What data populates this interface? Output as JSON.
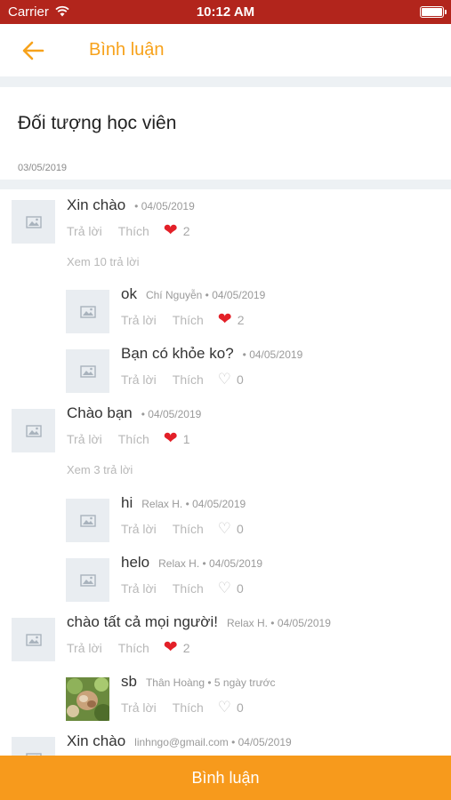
{
  "status_bar": {
    "carrier": "Carrier",
    "time": "10:12 AM"
  },
  "header": {
    "title": "Bình luận",
    "back_icon": "arrow-left-icon"
  },
  "post": {
    "title": "Đối tượng học viên",
    "date": "03/05/2019"
  },
  "actions": {
    "reply": "Trả lời",
    "like": "Thích"
  },
  "comments": [
    {
      "text": "Xin chào",
      "meta": "• 04/05/2019",
      "likes": "2",
      "liked": true,
      "view_more": "Xem 10 trả lời",
      "replies": [
        {
          "text": "ok",
          "meta": "Chí Nguyễn • 04/05/2019",
          "likes": "2",
          "liked": true
        },
        {
          "text": "Bạn có khỏe ko?",
          "meta": "• 04/05/2019",
          "likes": "0",
          "liked": false
        }
      ]
    },
    {
      "text": "Chào bạn",
      "meta": "• 04/05/2019",
      "likes": "1",
      "liked": true,
      "view_more": "Xem 3 trả lời",
      "replies": [
        {
          "text": "hi",
          "meta": "Relax H. • 04/05/2019",
          "likes": "0",
          "liked": false
        },
        {
          "text": "helo",
          "meta": "Relax H. • 04/05/2019",
          "likes": "0",
          "liked": false
        }
      ]
    },
    {
      "text": "chào tất cả mọi người!",
      "meta": "Relax H. • 04/05/2019",
      "likes": "2",
      "liked": true,
      "replies": [
        {
          "text": "sb",
          "meta": "Thân Hoàng • 5 ngày trước",
          "likes": "0",
          "liked": false
        }
      ]
    },
    {
      "text": "Xin chào",
      "meta": "linhngo@gmail.com • 04/05/2019"
    }
  ],
  "bottom_button": {
    "label": "Bình luận"
  },
  "colors": {
    "status_bar": "#b2251c",
    "accent": "#f79a1c",
    "title": "#f7a21b",
    "heart": "#e32028",
    "separator": "#edf1f4"
  }
}
